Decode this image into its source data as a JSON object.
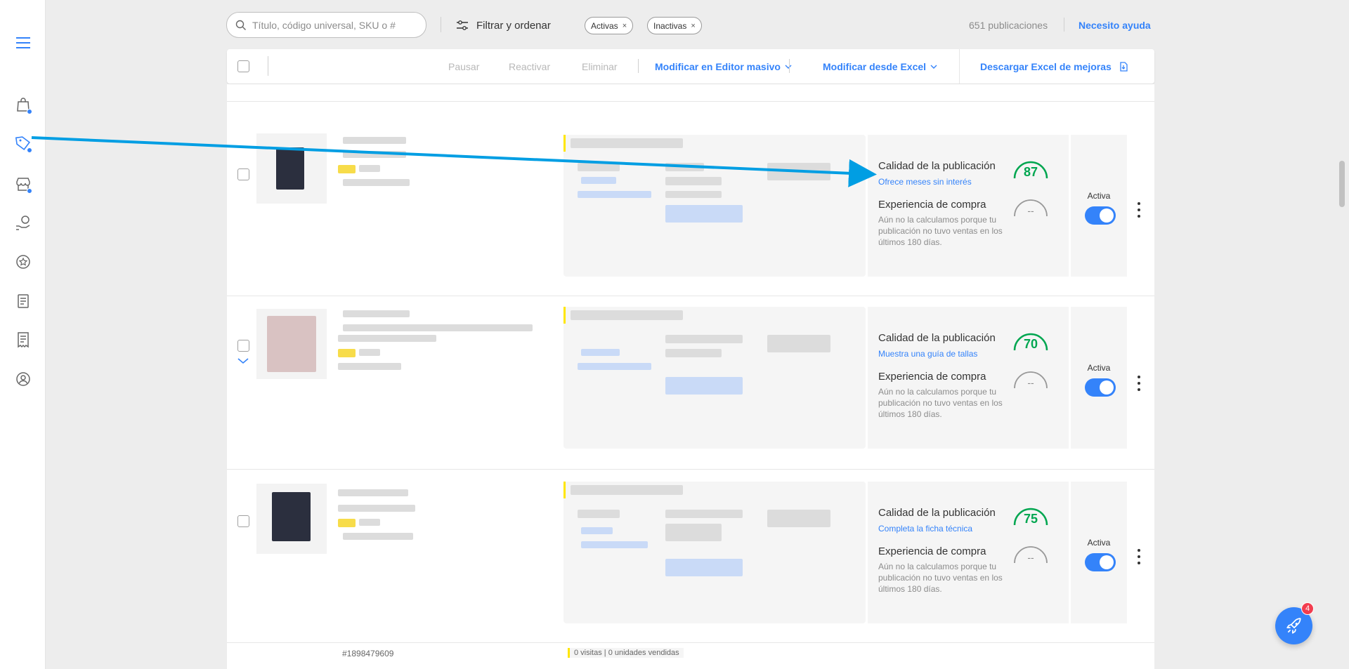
{
  "search": {
    "placeholder": "Título, código universal, SKU o #"
  },
  "toolbar": {
    "filter_label": "Filtrar y ordenar",
    "chips": [
      {
        "label": "Activas",
        "close": "×"
      },
      {
        "label": "Inactivas",
        "close": "×"
      }
    ],
    "count_label": "651 publicaciones",
    "help_label": "Necesito ayuda"
  },
  "actionbar": {
    "pause": "Pausar",
    "reactivate": "Reactivar",
    "delete": "Eliminar",
    "bulk_editor": "Modificar en Editor masivo",
    "from_excel": "Modificar desde Excel",
    "download_excel": "Descargar Excel de mejoras"
  },
  "listings": [
    {
      "quality_title": "Calidad de la publicación",
      "quality_score": "87",
      "quality_tip": "Ofrece meses sin interés",
      "experience_title": "Experiencia de compra",
      "experience_score": "--",
      "experience_desc": "Aún no la calculamos porque tu publicación no tuvo ventas en los últimos 180 días.",
      "status_label": "Activa",
      "active": true
    },
    {
      "quality_title": "Calidad de la publicación",
      "quality_score": "70",
      "quality_tip": "Muestra una guía de tallas",
      "experience_title": "Experiencia de compra",
      "experience_score": "--",
      "experience_desc": "Aún no la calculamos porque tu publicación no tuvo ventas en los últimos 180 días.",
      "status_label": "Activa",
      "active": true
    },
    {
      "quality_title": "Calidad de la publicación",
      "quality_score": "75",
      "quality_tip": "Completa la ficha técnica",
      "experience_title": "Experiencia de compra",
      "experience_score": "--",
      "experience_desc": "Aún no la calculamos porque tu publicación no tuvo ventas en los últimos 180 días.",
      "status_label": "Activa",
      "active": true
    }
  ],
  "bottom_row": {
    "id": "#1898479609",
    "stats": "0 visitas | 0 unidades vendidas"
  },
  "fab": {
    "badge": "4"
  },
  "colors": {
    "accent": "#3483fa",
    "score_green": "#00a650",
    "annotation_arrow": "#009ee3",
    "badge_red": "#f23d4f"
  },
  "icons": {
    "sidebar": [
      "menu-icon",
      "shopping-bag-icon",
      "tag-icon",
      "store-icon",
      "money-hand-icon",
      "star-badge-icon",
      "checklist-icon",
      "receipt-icon",
      "user-circle-icon"
    ],
    "fab": "rocket-icon"
  }
}
